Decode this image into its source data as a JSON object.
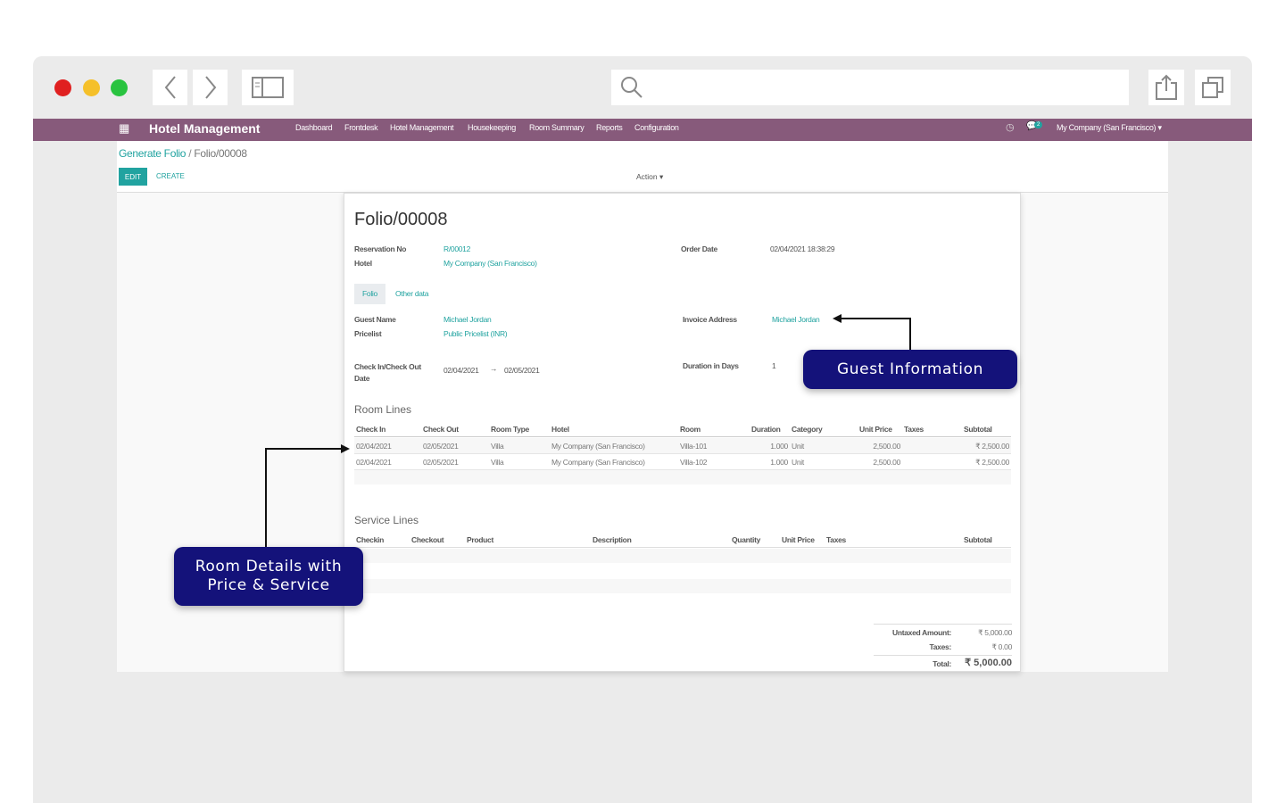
{
  "browser": {
    "icons": [
      "back-icon",
      "forward-icon",
      "sidebar-icon",
      "search-icon",
      "share-icon",
      "duplicate-icon"
    ],
    "traffic_colors": [
      "#e02020",
      "#f5c02a",
      "#29c33f"
    ]
  },
  "nav": {
    "app_title": "Hotel Management",
    "menu": [
      "Dashboard",
      "Frontdesk",
      "Hotel Management",
      "Housekeeping",
      "Room Summary",
      "Reports",
      "Configuration"
    ],
    "message_count": "2",
    "company": "My Company (San Francisco)",
    "color": "#875a7b"
  },
  "breadcrumb": {
    "parent": "Generate Folio",
    "current": "Folio/00008"
  },
  "toolbar": {
    "edit": "EDIT",
    "create": "CREATE",
    "action": "Action"
  },
  "form": {
    "title": "Folio/00008",
    "reservation_label": "Reservation No",
    "reservation": "R/00012",
    "hotel_label": "Hotel",
    "hotel": "My Company (San Francisco)",
    "order_date_label": "Order Date",
    "order_date": "02/04/2021 18:38:29",
    "tabs": [
      "Folio",
      "Other data"
    ],
    "guest_label": "Guest Name",
    "guest": "Michael Jordan",
    "pricelist_label": "Pricelist",
    "pricelist": "Public Pricelist (INR)",
    "invoice_label": "Invoice Address",
    "invoice": "Michael Jordan",
    "checkinout_label": "Check In/Check Out Date",
    "checkin": "02/04/2021",
    "checkout": "02/05/2021",
    "duration_label": "Duration in Days",
    "duration": "1"
  },
  "room_lines": {
    "title": "Room Lines",
    "headers": [
      "Check In",
      "Check Out",
      "Room Type",
      "Hotel",
      "Room",
      "Duration",
      "Category",
      "Unit Price",
      "Taxes",
      "Subtotal"
    ],
    "rows": [
      [
        "02/04/2021",
        "02/05/2021",
        "Villa",
        "My Company (San Francisco)",
        "Villa-101",
        "1.000",
        "Unit",
        "2,500.00",
        "",
        "₹ 2,500.00"
      ],
      [
        "02/04/2021",
        "02/05/2021",
        "Villa",
        "My Company (San Francisco)",
        "Villa-102",
        "1.000",
        "Unit",
        "2,500.00",
        "",
        "₹ 2,500.00"
      ]
    ]
  },
  "service_lines": {
    "title": "Service Lines",
    "headers": [
      "Checkin",
      "Checkout",
      "Product",
      "Description",
      "Quantity",
      "Unit Price",
      "Taxes",
      "Subtotal"
    ]
  },
  "totals": {
    "untaxed_label": "Untaxed Amount:",
    "untaxed": "₹ 5,000.00",
    "taxes_label": "Taxes:",
    "taxes": "₹ 0.00",
    "total_label": "Total:",
    "total": "₹ 5,000.00"
  },
  "callouts": {
    "guest": "Guest Information",
    "room": "Room Details with Price & Service",
    "color": "#14127a"
  }
}
